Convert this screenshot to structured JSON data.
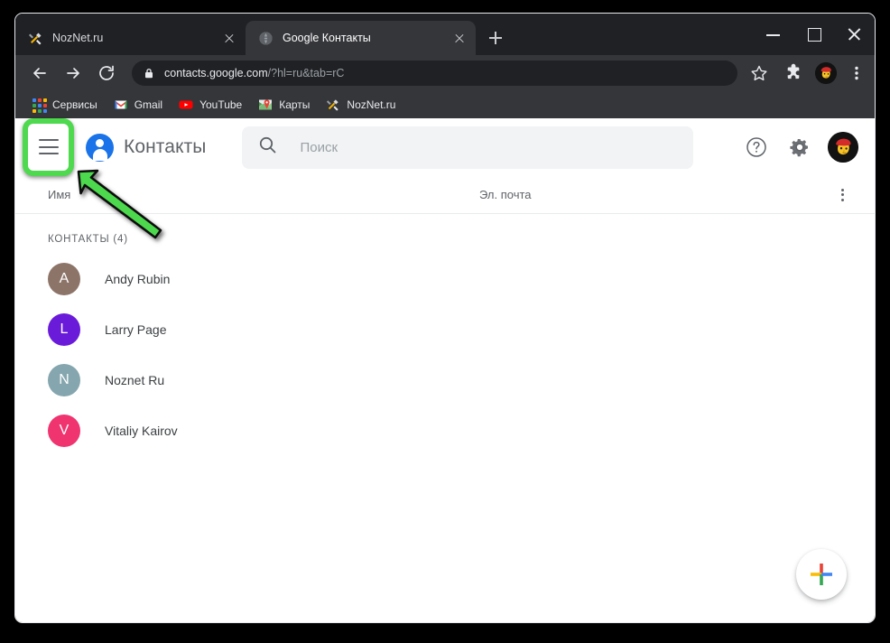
{
  "browser": {
    "tabs": [
      {
        "title": "NozNet.ru",
        "favicon": "tools-icon",
        "active": false
      },
      {
        "title": "Google Контакты",
        "favicon": "globe-icon",
        "active": true
      }
    ],
    "new_tab_label": "+",
    "window_controls": {
      "minimize": "—",
      "maximize": "□",
      "close": "✕"
    },
    "omnibox": {
      "url_host": "contacts.google.com",
      "url_path": "/?hl=ru&tab=rC",
      "lock_icon": "lock-icon"
    },
    "toolbar_icons": [
      "back-icon",
      "forward-icon",
      "reload-icon",
      "bookmark-star-icon",
      "extensions-puzzle-icon",
      "profile-avatar-icon",
      "chrome-menu-icon"
    ],
    "bookmarks": [
      {
        "label": "Сервисы",
        "icon": "apps-grid-icon"
      },
      {
        "label": "Gmail",
        "icon": "gmail-icon"
      },
      {
        "label": "YouTube",
        "icon": "youtube-icon"
      },
      {
        "label": "Карты",
        "icon": "maps-icon"
      },
      {
        "label": "NozNet.ru",
        "icon": "tools-icon"
      }
    ]
  },
  "app": {
    "title": "Контакты",
    "menu_icon": "hamburger-menu-icon",
    "brand_icon": "contacts-person-icon",
    "search": {
      "placeholder": "Поиск",
      "icon": "search-icon",
      "value": ""
    },
    "header_actions": [
      {
        "name": "help",
        "icon": "help-circle-icon"
      },
      {
        "name": "settings",
        "icon": "gear-icon"
      },
      {
        "name": "account",
        "icon": "user-avatar-icon"
      }
    ],
    "columns": {
      "name": "Имя",
      "email": "Эл. почта",
      "more_icon": "more-vertical-icon"
    },
    "section_label": "КОНТАКТЫ (4)",
    "contacts": [
      {
        "initial": "A",
        "name": "Andy Rubin",
        "email": "",
        "color": "#8d7469"
      },
      {
        "initial": "L",
        "name": "Larry Page",
        "email": "",
        "color": "#6a1bda"
      },
      {
        "initial": "N",
        "name": "Noznet Ru",
        "email": "",
        "color": "#85a6ae"
      },
      {
        "initial": "V",
        "name": "Vitaliy Kairov",
        "email": "",
        "color": "#ef3470"
      }
    ],
    "fab": {
      "name": "create-contact-button",
      "icon": "plus-icon",
      "colors": {
        "top": "#ea4335",
        "left": "#fbbc04",
        "bottom": "#34a853",
        "right": "#4285f4"
      }
    }
  },
  "annotation": {
    "highlight_color": "#4ed94e",
    "target": "hamburger-menu-icon",
    "arrow": "green-arrow-pointing-up-left"
  }
}
